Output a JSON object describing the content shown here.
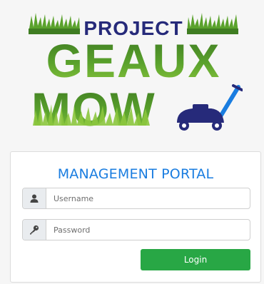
{
  "logo": {
    "line1": "PROJECT",
    "line2": "GEAUX",
    "line3": "MOW",
    "colors": {
      "green_dark": "#3f7d22",
      "green_light": "#8cc63e",
      "navy": "#262a7a",
      "blue": "#1a7de0"
    }
  },
  "portal": {
    "title": "MANAGEMENT PORTAL",
    "username": {
      "placeholder": "Username",
      "icon": "user-icon"
    },
    "password": {
      "placeholder": "Password",
      "icon": "key-icon"
    },
    "login_label": "Login",
    "login_color": "#28a745"
  }
}
